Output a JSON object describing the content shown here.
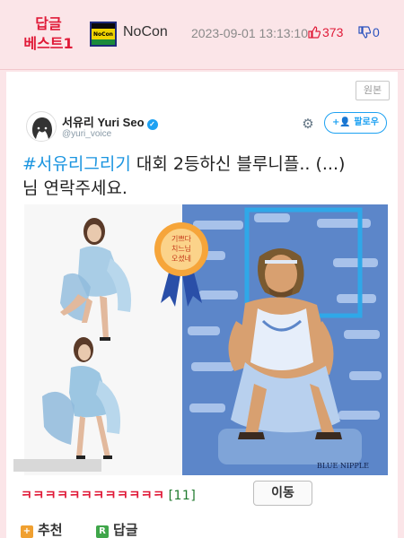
{
  "header": {
    "best_label_line1": "답글",
    "best_label_line2": "베스트1",
    "nick_icon_text": "NoCon",
    "nickname": "NoCon",
    "datetime": "2023-09-01 13:13:10",
    "upvotes": "373",
    "downvotes": "0"
  },
  "post": {
    "original_button": "원본",
    "tweet": {
      "name": "서유리 Yuri Seo",
      "handle": "@yuri_voice",
      "follow_label": "팔로우",
      "hashtag": "#서유리그리기",
      "text_after_hashtag": " 대회 2등하신 블루니플.. (...)",
      "text_line2": "님 연락주세요."
    },
    "ribbon_text": [
      "기쁘다",
      "치느님",
      "오셨네"
    ],
    "art_signature": "BLUE NIPPLE",
    "laugh_text": "ㅋㅋㅋㅋㅋㅋㅋㅋㅋㅋㅋㅋ",
    "laugh_count": "[11]",
    "move_button": "이동"
  },
  "actions": {
    "recommend_label": "추천",
    "reply_label": "답글"
  },
  "colors": {
    "header_bg": "#fbe5e8",
    "accent_red": "#e01a38",
    "accent_blue": "#2a52be",
    "twitter_blue": "#1da1f2",
    "art_bg": "#5c86c9"
  }
}
